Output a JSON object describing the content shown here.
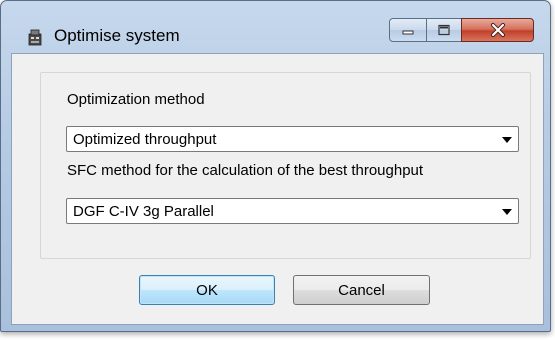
{
  "window": {
    "title": "Optimise system",
    "icons": {
      "app": "app-icon",
      "minimize": "minimize-icon",
      "maximize": "maximize-icon",
      "close": "close-icon"
    }
  },
  "form": {
    "method_label": "Optimization method",
    "method_value": "Optimized throughput",
    "sfc_label": "SFC method for the calculation of the best throughput",
    "sfc_value": "DGF C-IV 3g Parallel"
  },
  "buttons": {
    "ok": "OK",
    "cancel": "Cancel"
  },
  "colors": {
    "close_button": "#c2402a",
    "default_button_border": "#3c7fb1",
    "window_frame": "#b6cbe4"
  }
}
